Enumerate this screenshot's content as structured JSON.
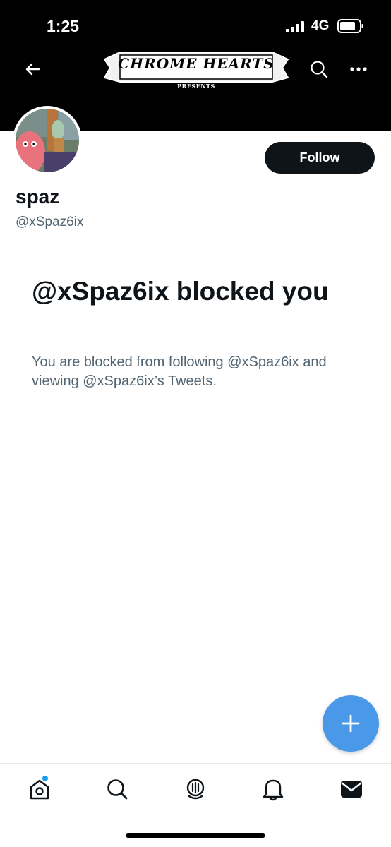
{
  "status_bar": {
    "time": "1:25",
    "network": "4G"
  },
  "banner": {
    "logo_text": "CHROME HEARTS",
    "logo_sub": "PRESENTS",
    "back_icon": "arrow-left-icon",
    "search_icon": "search-icon",
    "more_icon": "more-horizontal-icon"
  },
  "profile": {
    "display_name": "spaz",
    "handle": "@xSpaz6ix",
    "follow_label": "Follow"
  },
  "blocked": {
    "title": "@xSpaz6ix blocked you",
    "description": "You are blocked from following @xSpaz6ix and viewing @xSpaz6ix’s Tweets."
  },
  "tabs": [
    {
      "name": "home-icon"
    },
    {
      "name": "search-icon"
    },
    {
      "name": "spaces-icon"
    },
    {
      "name": "notifications-icon"
    },
    {
      "name": "messages-icon"
    }
  ],
  "colors": {
    "accent": "#1d9bf0",
    "fab": "#4a99e9",
    "text_primary": "#0f1419",
    "text_secondary": "#536471"
  }
}
